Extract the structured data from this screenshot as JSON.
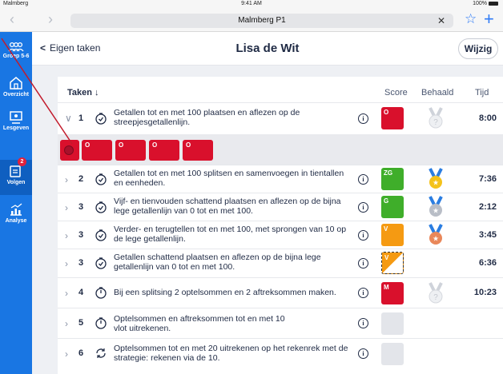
{
  "status": {
    "carrier": "Malmberg",
    "time": "9:41 AM",
    "battery": "100%"
  },
  "browser": {
    "url": "Malmberg P1",
    "clear": "✕",
    "back_glyph": "‹",
    "forward_glyph": "›",
    "bookmark_glyph": "☆",
    "new_tab_glyph": "+"
  },
  "sidebar": {
    "accent": "#1976e3",
    "items": [
      {
        "label": "Groep 5-6",
        "icon": "group-icon"
      },
      {
        "label": "Overzicht",
        "icon": "home-icon"
      },
      {
        "label": "Lesgeven",
        "icon": "teach-icon"
      },
      {
        "label": "Volgen",
        "icon": "follow-icon",
        "badge": "2"
      },
      {
        "label": "Analyse",
        "icon": "chart-icon"
      }
    ]
  },
  "header": {
    "back_label": "Eigen taken",
    "title": "Lisa de Wit",
    "edit_label": "Wijzig"
  },
  "table": {
    "headers": {
      "tasks": "Taken",
      "sort_arrow": "↓",
      "score": "Score",
      "achieved": "Behaald",
      "time": "Tijd"
    },
    "rows": [
      {
        "expand": "∨",
        "num": "1",
        "text": "Getallen tot en met 100 plaatsen en aflezen op de streepjesgetallenlijn.",
        "score": "O",
        "score_color": "red",
        "medal": "silver-faded",
        "time": "8:00"
      },
      {
        "expand": "›",
        "num": "2",
        "text": "Getallen tot en met 100 splitsen en samenvoegen in tientallen en eenheden.",
        "score": "ZG",
        "score_color": "green",
        "medal": "gold",
        "time": "7:36"
      },
      {
        "expand": "›",
        "num": "3",
        "text": "Vijf- en tienvouden schattend plaatsen en aflezen op de bijna lege getallenlijn van 0 tot en met 100.",
        "score": "G",
        "score_color": "green",
        "medal": "silver",
        "time": "2:12"
      },
      {
        "expand": "›",
        "num": "3",
        "text": "Verder- en terugtellen tot en met 100, met sprongen van 10 op de lege getallenlijn.",
        "score": "V",
        "score_color": "orange",
        "medal": "bronze",
        "time": "3:45"
      },
      {
        "expand": "›",
        "num": "3",
        "text": "Getallen schattend plaatsen en aflezen op de bijna lege getallenlijn van 0 tot en met 100.",
        "score": "V",
        "score_color": "partial",
        "medal": "",
        "time": "6:36"
      },
      {
        "expand": "›",
        "num": "4",
        "text": "Bij een splitsing 2 optelsommen en 2 aftreksommen maken.",
        "score": "M",
        "score_color": "red",
        "medal": "silver-faded",
        "time": "10:23"
      },
      {
        "expand": "›",
        "num": "5",
        "text": "Optelsommen en aftreksommen tot en met 10 vlot uitrekenen.",
        "score": "",
        "score_color": "empty",
        "medal": "",
        "time": ""
      },
      {
        "expand": "›",
        "num": "6",
        "text": "Optelsommen tot en met 20 uitrekenen op het rekenrek met de strategie: rekenen via de 10.",
        "score": "",
        "score_color": "empty",
        "medal": "",
        "time": ""
      }
    ],
    "attempts": [
      "O",
      "O",
      "O",
      "O"
    ]
  }
}
